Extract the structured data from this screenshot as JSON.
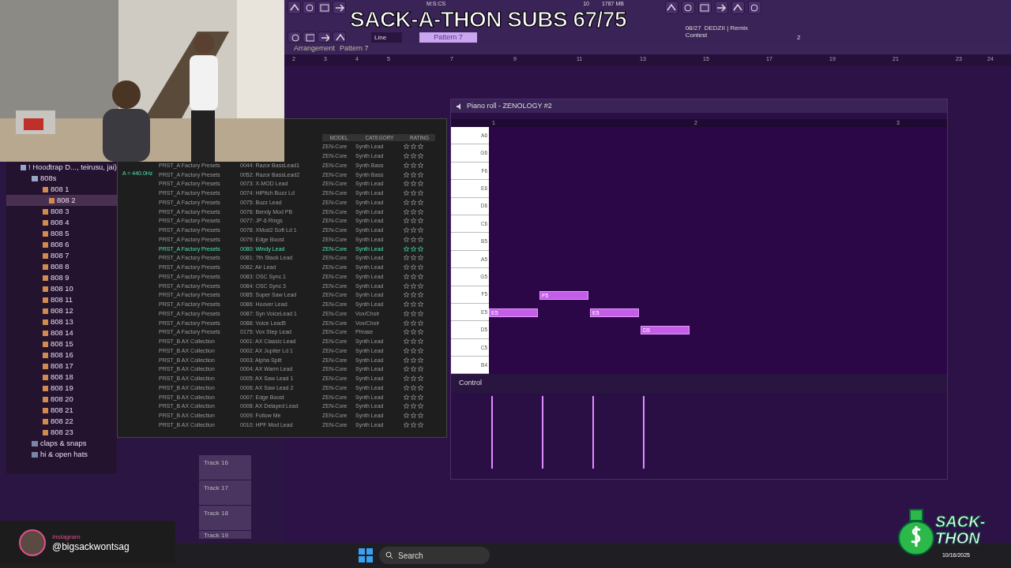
{
  "overlay": {
    "title": "SACK-A-THON SUBS 67/75"
  },
  "toolbar": {
    "time_label": "M:S:CS",
    "cpu": "10",
    "memory": "1787 MB",
    "snap": "Line",
    "pattern": "Pattern 7",
    "news_date": "08/27",
    "news_title": "DEDZII | Remix",
    "news_subtitle": "Contest",
    "news_count": "2"
  },
  "playlist": {
    "breadcrumb": [
      "Arrangement",
      "Pattern 7"
    ],
    "ruler": [
      "2",
      "3",
      "4",
      "5",
      "7",
      "9",
      "11",
      "13",
      "15",
      "17",
      "19",
      "21",
      "23",
      "24"
    ],
    "tracks": [
      "Track 16",
      "Track 17",
      "Track 18",
      "Track 19"
    ]
  },
  "browser": {
    "tree": [
      {
        "label": "! Hoodtrap D..., teirusu, jai)",
        "expanded": true,
        "children": [
          {
            "label": "808s",
            "expanded": true,
            "children": [
              {
                "label": "808 1",
                "selected": false
              },
              {
                "label": "808 2",
                "selected": true
              },
              {
                "label": "808 3",
                "selected": false
              },
              {
                "label": "808 4",
                "selected": false
              },
              {
                "label": "808 5",
                "selected": false
              },
              {
                "label": "808 6",
                "selected": false
              },
              {
                "label": "808 7",
                "selected": false
              },
              {
                "label": "808 8",
                "selected": false
              },
              {
                "label": "808 9",
                "selected": false
              },
              {
                "label": "808 10",
                "selected": false
              },
              {
                "label": "808 11",
                "selected": false
              },
              {
                "label": "808 12",
                "selected": false
              },
              {
                "label": "808 13",
                "selected": false
              },
              {
                "label": "808 14",
                "selected": false
              },
              {
                "label": "808 15",
                "selected": false
              },
              {
                "label": "808 16",
                "selected": false
              },
              {
                "label": "808 17",
                "selected": false
              },
              {
                "label": "808 18",
                "selected": false
              },
              {
                "label": "808 19",
                "selected": false
              },
              {
                "label": "808 20",
                "selected": false
              },
              {
                "label": "808 21",
                "selected": false
              },
              {
                "label": "808 22",
                "selected": false
              },
              {
                "label": "808 23",
                "selected": false
              }
            ]
          },
          {
            "label": "claps & snaps",
            "expanded": false
          },
          {
            "label": "hi & open hats",
            "expanded": false
          }
        ]
      }
    ]
  },
  "plugin": {
    "tuner": "A = 440.0Hz",
    "columns": [
      "MODEL",
      "CATEGORY",
      "RATING"
    ],
    "rows": [
      {
        "model": "ZEN-Core",
        "category": "Synth Lead",
        "stars": 0,
        "selected": false
      },
      {
        "model": "ZEN-Core",
        "category": "Synth Lead",
        "stars": 0,
        "selected": false
      },
      {
        "bank": "PRST_A Factory Presets",
        "name": "0044: Razor BassLead1",
        "model": "ZEN-Core",
        "category": "Synth Bass",
        "stars": 0,
        "selected": false
      },
      {
        "bank": "PRST_A Factory Presets",
        "name": "0052: Razor BassLead2",
        "model": "ZEN-Core",
        "category": "Synth Bass",
        "stars": 0,
        "selected": false
      },
      {
        "bank": "PRST_A Factory Presets",
        "name": "0073: X-MOD Lead",
        "model": "ZEN-Core",
        "category": "Synth Lead",
        "stars": 0,
        "selected": false
      },
      {
        "bank": "PRST_A Factory Presets",
        "name": "0074: HiPitch Buzz Ld",
        "model": "ZEN-Core",
        "category": "Synth Lead",
        "stars": 0,
        "selected": false
      },
      {
        "bank": "PRST_A Factory Presets",
        "name": "0075: Buzz Lead",
        "model": "ZEN-Core",
        "category": "Synth Lead",
        "stars": 0,
        "selected": false
      },
      {
        "bank": "PRST_A Factory Presets",
        "name": "0076: Bendy Mod PB",
        "model": "ZEN-Core",
        "category": "Synth Lead",
        "stars": 0,
        "selected": false
      },
      {
        "bank": "PRST_A Factory Presets",
        "name": "0077: JP-6 Rings",
        "model": "ZEN-Core",
        "category": "Synth Lead",
        "stars": 0,
        "selected": false
      },
      {
        "bank": "PRST_A Factory Presets",
        "name": "0078: XMod2 Soft Ld 1",
        "model": "ZEN-Core",
        "category": "Synth Lead",
        "stars": 0,
        "selected": false
      },
      {
        "bank": "PRST_A Factory Presets",
        "name": "0079: Edge Boost",
        "model": "ZEN-Core",
        "category": "Synth Lead",
        "stars": 0,
        "selected": false
      },
      {
        "bank": "PRST_A Factory Presets",
        "name": "0080: Windy Lead",
        "model": "ZEN-Core",
        "category": "Synth Lead",
        "stars": 0,
        "selected": true
      },
      {
        "bank": "PRST_A Factory Presets",
        "name": "0081: 7th Stack Lead",
        "model": "ZEN-Core",
        "category": "Synth Lead",
        "stars": 0,
        "selected": false
      },
      {
        "bank": "PRST_A Factory Presets",
        "name": "0082: Air Lead",
        "model": "ZEN-Core",
        "category": "Synth Lead",
        "stars": 0,
        "selected": false
      },
      {
        "bank": "PRST_A Factory Presets",
        "name": "0083: OSC Sync 1",
        "model": "ZEN-Core",
        "category": "Synth Lead",
        "stars": 0,
        "selected": false
      },
      {
        "bank": "PRST_A Factory Presets",
        "name": "0084: OSC Sync 3",
        "model": "ZEN-Core",
        "category": "Synth Lead",
        "stars": 0,
        "selected": false
      },
      {
        "bank": "PRST_A Factory Presets",
        "name": "0085: Super Saw Lead",
        "model": "ZEN-Core",
        "category": "Synth Lead",
        "stars": 0,
        "selected": false
      },
      {
        "bank": "PRST_A Factory Presets",
        "name": "0086: Hoover Lead",
        "model": "ZEN-Core",
        "category": "Synth Lead",
        "stars": 0,
        "selected": false
      },
      {
        "bank": "PRST_A Factory Presets",
        "name": "0087: Syn VoiceLead 1",
        "model": "ZEN-Core",
        "category": "Vox/Choir",
        "stars": 0,
        "selected": false
      },
      {
        "bank": "PRST_A Factory Presets",
        "name": "0088: Voice Lead5",
        "model": "ZEN-Core",
        "category": "Vox/Choir",
        "stars": 0,
        "selected": false
      },
      {
        "bank": "PRST_A Factory Presets",
        "name": "0175: Vox Step Lead",
        "model": "ZEN-Core",
        "category": "Phrase",
        "stars": 0,
        "selected": false
      },
      {
        "bank": "PRST_B AX Collection",
        "name": "0001: AX Classic Lead",
        "model": "ZEN-Core",
        "category": "Synth Lead",
        "stars": 0,
        "selected": false
      },
      {
        "bank": "PRST_B AX Collection",
        "name": "0002: AX Jupiter Ld 1",
        "model": "ZEN-Core",
        "category": "Synth Lead",
        "stars": 0,
        "selected": false
      },
      {
        "bank": "PRST_B AX Collection",
        "name": "0003: Alpha Split",
        "model": "ZEN-Core",
        "category": "Synth Lead",
        "stars": 0,
        "selected": false
      },
      {
        "bank": "PRST_B AX Collection",
        "name": "0004: AX Warm Lead",
        "model": "ZEN-Core",
        "category": "Synth Lead",
        "stars": 0,
        "selected": false
      },
      {
        "bank": "PRST_B AX Collection",
        "name": "0005: AX Saw Lead 1",
        "model": "ZEN-Core",
        "category": "Synth Lead",
        "stars": 0,
        "selected": false
      },
      {
        "bank": "PRST_B AX Collection",
        "name": "0006: AX Saw Lead 2",
        "model": "ZEN-Core",
        "category": "Synth Lead",
        "stars": 0,
        "selected": false
      },
      {
        "bank": "PRST_B AX Collection",
        "name": "0007: Edge Boost",
        "model": "ZEN-Core",
        "category": "Synth Lead",
        "stars": 0,
        "selected": false
      },
      {
        "bank": "PRST_B AX Collection",
        "name": "0008: AX Delayed Lead",
        "model": "ZEN-Core",
        "category": "Synth Lead",
        "stars": 0,
        "selected": false
      },
      {
        "bank": "PRST_B AX Collection",
        "name": "0009: Follow Me",
        "model": "ZEN-Core",
        "category": "Synth Lead",
        "stars": 0,
        "selected": false
      },
      {
        "bank": "PRST_B AX Collection",
        "name": "0010: HPF Mod Lead",
        "model": "ZEN-Core",
        "category": "Synth Lead",
        "stars": 0,
        "selected": false
      }
    ]
  },
  "piano_roll": {
    "title": "Piano roll - ZENOLOGY #2",
    "ruler": [
      "1",
      "2",
      "3"
    ],
    "keys": [
      "A6",
      "G6",
      "F6",
      "E6",
      "D6",
      "C6",
      "B5",
      "A5",
      "G5",
      "F5",
      "E5",
      "D5",
      "C5",
      "B4"
    ],
    "notes": [
      {
        "label": "E5"
      },
      {
        "label": "F5"
      },
      {
        "label": "E5"
      },
      {
        "label": "D5"
      }
    ],
    "control_label": "Control"
  },
  "stream": {
    "instagram_label": "Instagram",
    "handle": "@bigsackwontsag",
    "logo_top": "SACK-",
    "logo_bottom": "THON"
  },
  "taskbar": {
    "search": "Search",
    "date": "10/16/2025"
  }
}
